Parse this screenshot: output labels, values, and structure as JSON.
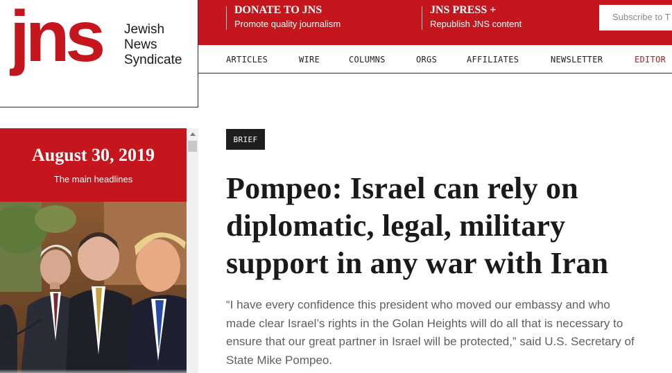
{
  "logo": {
    "mark": "jns",
    "name_lines": [
      "Jewish",
      "News",
      "Syndicate"
    ]
  },
  "promos": {
    "donate": {
      "title": "DONATE TO JNS",
      "subtitle": "Promote quality journalism"
    },
    "press": {
      "title": "JNS PRESS +",
      "subtitle": "Republish JNS content"
    }
  },
  "subscribe": {
    "label": "Subscribe to T"
  },
  "nav": {
    "items": [
      "ARTICLES",
      "WIRE",
      "COLUMNS",
      "ORGS",
      "AFFILIATES",
      "NEWSLETTER",
      "EDITOR"
    ]
  },
  "headlines_panel": {
    "date": "August 30, 2019",
    "subtitle": "The main headlines"
  },
  "article": {
    "badge": "BRIEF",
    "headline": "Pompeo: Israel can rely on diplomatic, legal, military support in any war with Iran",
    "dek": "“I have every confidence this president who moved our embassy and who made clear Israel’s rights in the Golan Heights will do all that is necessary to ensure that our great partner in Israel will be protected,” said U.S. Secretary of State Mike Pompeo."
  },
  "colors": {
    "brand_red": "#c4161c",
    "badge_dark": "#1e1e1e",
    "dek_gray": "#5f5f5f"
  }
}
